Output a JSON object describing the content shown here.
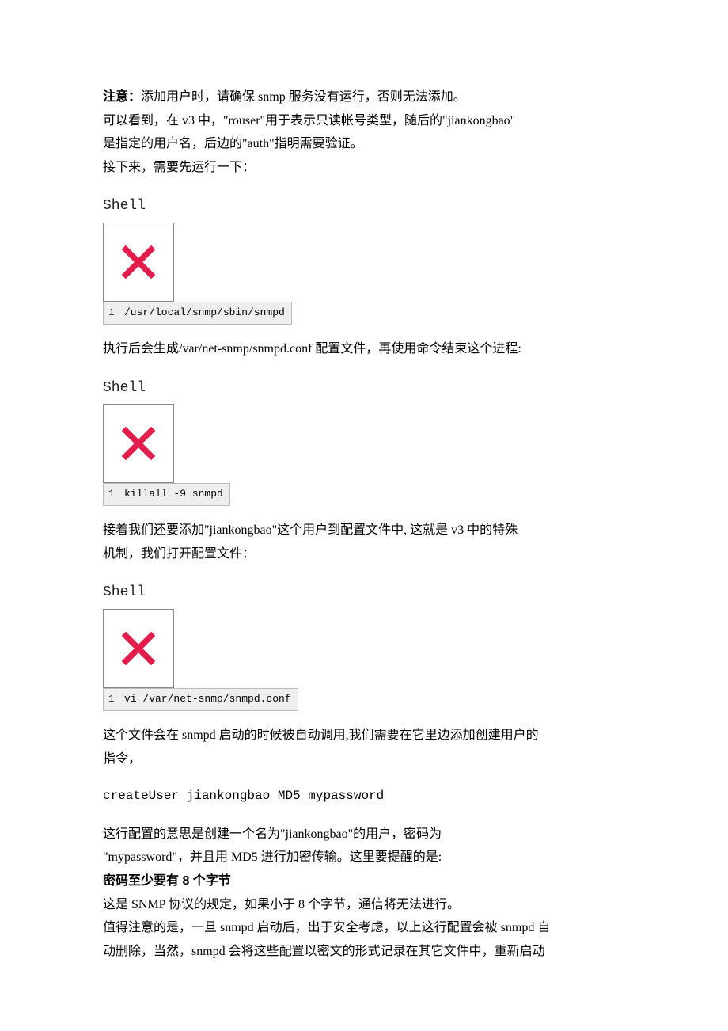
{
  "para1": {
    "lead": "注意：",
    "rest": "添加用户时，请确保 snmp 服务没有运行，否则无法添加。"
  },
  "para2_l1": "可以看到，在 v3 中，\"rouser\"用于表示只读帐号类型，随后的\"jiankongbao\"",
  "para2_l2": "是指定的用户名，后边的\"auth\"指明需要验证。",
  "para3": "接下来，需要先运行一下：",
  "shell_label": "Shell",
  "code1": {
    "ln": "1",
    "cmd": "/usr/local/snmp/sbin/snmpd"
  },
  "para4": "执行后会生成/var/net-snmp/snmpd.conf 配置文件，再使用命令结束这个进程:",
  "code2": {
    "ln": "1",
    "cmd": "killall -9 snmpd"
  },
  "para5_l1": "接着我们还要添加\"jiankongbao\"这个用户到配置文件中, 这就是 v3 中的特殊",
  "para5_l2": "机制，我们打开配置文件：",
  "code3": {
    "ln": "1",
    "cmd": "vi /var/net-snmp/snmpd.conf"
  },
  "para6_l1": "这个文件会在 snmpd 启动的时候被自动调用,我们需要在它里边添加创建用户的",
  "para6_l2": "指令，",
  "create_line": "createUser jiankongbao MD5 mypassword",
  "para7_l1": "这行配置的意思是创建一个名为\"jiankongbao\"的用户，密码为",
  "para7_l2": "\"mypassword\"，并且用 MD5 进行加密传输。这里要提醒的是:",
  "pw_rule": "密码至少要有 8 个字节",
  "para8": "这是 SNMP 协议的规定，如果小于 8 个字节，通信将无法进行。",
  "para9_l1": "值得注意的是，一旦 snmpd 启动后，出于安全考虑，以上这行配置会被 snmpd 自",
  "para9_l2": "动删除，当然，snmpd 会将这些配置以密文的形式记录在其它文件中，重新启动"
}
